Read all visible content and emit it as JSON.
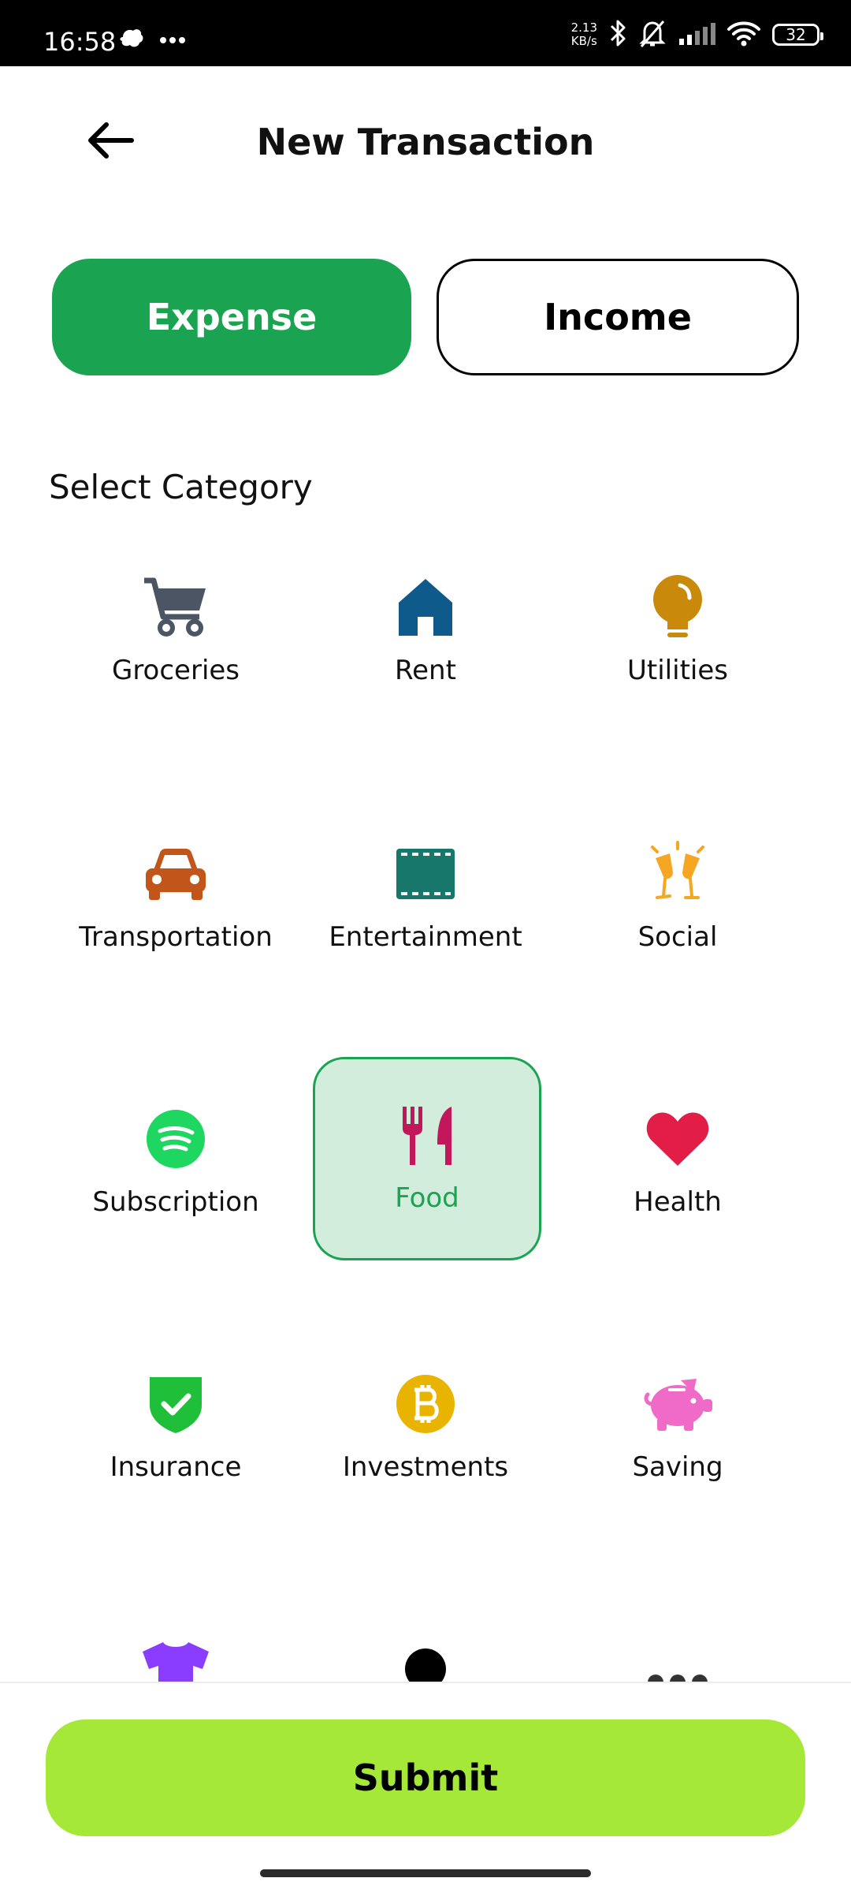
{
  "status_bar": {
    "time": "16:58",
    "speed_value": "2.13",
    "speed_unit": "KB/s",
    "battery": "32",
    "icons": [
      "notification-icon",
      "more-dots-icon",
      "bluetooth-icon",
      "mute-bell-icon",
      "signal-icon",
      "wifi-icon",
      "battery-icon"
    ]
  },
  "header": {
    "title": "New Transaction",
    "back_icon": "arrow-left-icon"
  },
  "type_toggle": {
    "expense_label": "Expense",
    "income_label": "Income",
    "selected": "Expense",
    "selected_color": "#1aa350"
  },
  "category_section": {
    "title": "Select Category",
    "selected": "Food",
    "items": [
      {
        "label": "Groceries",
        "icon": "shopping-cart-icon",
        "color": "#4b5563"
      },
      {
        "label": "Rent",
        "icon": "house-icon",
        "color": "#0e5a8a"
      },
      {
        "label": "Utilities",
        "icon": "lightbulb-icon",
        "color": "#c98a0b"
      },
      {
        "label": "Transportation",
        "icon": "car-icon",
        "color": "#c2561a"
      },
      {
        "label": "Entertainment",
        "icon": "film-icon",
        "color": "#17776a"
      },
      {
        "label": "Social",
        "icon": "champagne-glasses-icon",
        "color": "#f5a623"
      },
      {
        "label": "Subscription",
        "icon": "spotify-icon",
        "color": "#1ed760"
      },
      {
        "label": "Food",
        "icon": "utensils-icon",
        "color": "#c2185b"
      },
      {
        "label": "Health",
        "icon": "heart-icon",
        "color": "#e11d48"
      },
      {
        "label": "Insurance",
        "icon": "shield-check-icon",
        "color": "#1fbf3a"
      },
      {
        "label": "Investments",
        "icon": "bitcoin-icon",
        "color": "#e8b400"
      },
      {
        "label": "Saving",
        "icon": "piggy-bank-icon",
        "color": "#f06ac8"
      },
      {
        "label": "",
        "icon": "tshirt-icon",
        "color": "#8b3dff"
      },
      {
        "label": "",
        "icon": "circle-icon",
        "color": "#000000"
      },
      {
        "label": "",
        "icon": "more-icon",
        "color": "#333333"
      }
    ]
  },
  "footer": {
    "submit_label": "Submit",
    "submit_color": "#a5e838"
  }
}
